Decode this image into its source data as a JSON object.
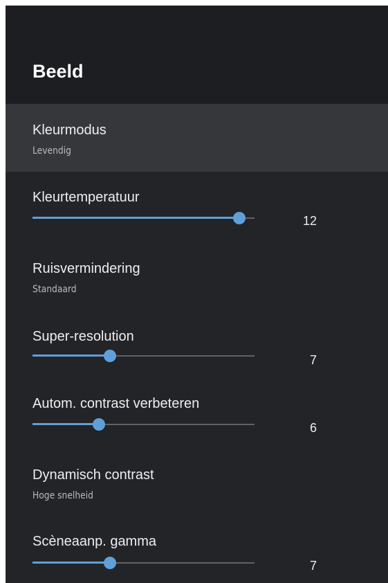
{
  "header": {
    "title": "Beeld"
  },
  "settings": [
    {
      "label": "Kleurmodus",
      "value": "Levendig",
      "type": "option",
      "selected": true
    },
    {
      "label": "Kleurtemperatuur",
      "value": "12",
      "type": "slider",
      "level": 0.93
    },
    {
      "label": "Ruisvermindering",
      "value": "Standaard",
      "type": "option"
    },
    {
      "label": "Super-resolution",
      "value": "7",
      "type": "slider",
      "level": 0.35
    },
    {
      "label": "Autom. contrast verbeteren",
      "value": "6",
      "type": "slider",
      "level": 0.3
    },
    {
      "label": "Dynamisch contrast",
      "value": "Hoge snelheid",
      "type": "option"
    },
    {
      "label": "Scèneaanp. gamma",
      "value": "7",
      "type": "slider",
      "level": 0.35
    }
  ],
  "colors": {
    "panel_background": "#232427",
    "header_background": "#1d1e21",
    "selected_row": "#36373b",
    "slider_accent": "#5fa0d9",
    "slider_track": "#616266"
  }
}
